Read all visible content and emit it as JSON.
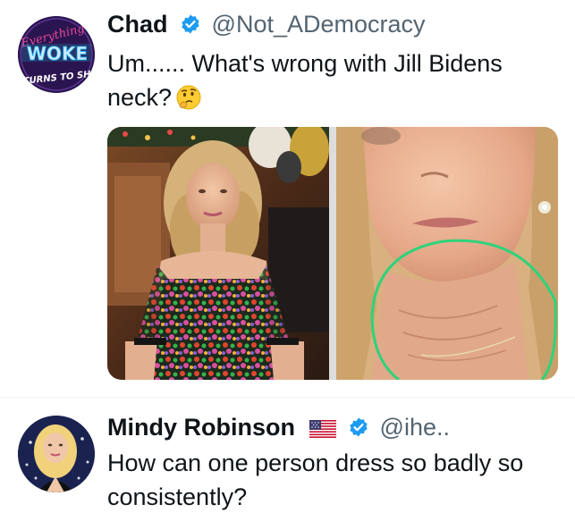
{
  "tweets": [
    {
      "author": {
        "name": "Chad",
        "handle": "@Not_ADemocracy",
        "verified": true,
        "avatar_text": [
          "Everything",
          "WOKE",
          "TURNS TO SH"
        ]
      },
      "text": "Um...... What's wrong with Jill Bidens\nneck?",
      "emoji": "thinking-face",
      "media": [
        {
          "name": "photo-woman-sequin-dress"
        },
        {
          "name": "photo-neck-closeup-circled"
        }
      ]
    },
    {
      "author": {
        "name": "Mindy Robinson",
        "handle": "@ihe..",
        "verified": true,
        "flag": "us-flag"
      },
      "text": "How can one person dress so badly so\nconsistently?"
    }
  ],
  "colors": {
    "verified": "#1d9bf0",
    "handle": "#536471",
    "circle": "#2fd27a"
  }
}
